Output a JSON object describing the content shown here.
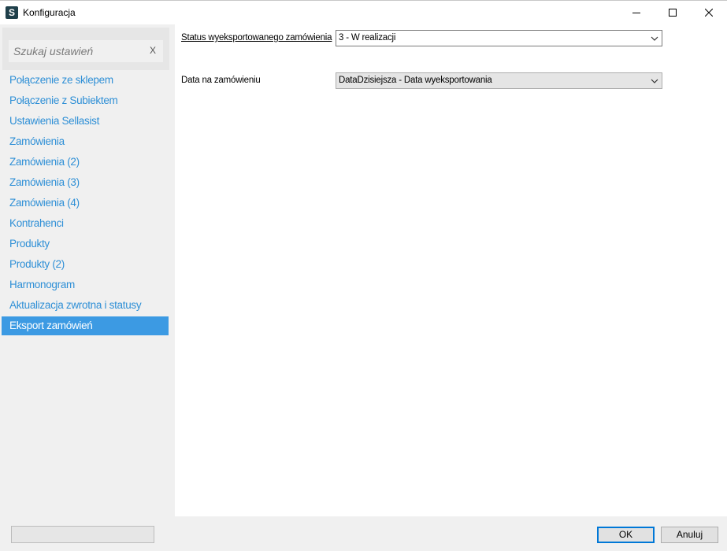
{
  "window": {
    "title": "Konfiguracja",
    "icon_letter": "S",
    "controls": [
      "minimize-icon",
      "maximize-icon",
      "close-icon"
    ]
  },
  "sidebar": {
    "search": {
      "placeholder": "Szukaj ustawień",
      "value": "",
      "clear_label": "X"
    },
    "items": [
      {
        "label": "Połączenie ze sklepem",
        "active": false
      },
      {
        "label": "Połączenie z Subiektem",
        "active": false
      },
      {
        "label": "Ustawienia Sellasist",
        "active": false
      },
      {
        "label": "Zamówienia",
        "active": false
      },
      {
        "label": "Zamówienia (2)",
        "active": false
      },
      {
        "label": "Zamówienia (3)",
        "active": false
      },
      {
        "label": "Zamówienia (4)",
        "active": false
      },
      {
        "label": "Kontrahenci",
        "active": false
      },
      {
        "label": "Produkty",
        "active": false
      },
      {
        "label": "Produkty (2)",
        "active": false
      },
      {
        "label": "Harmonogram",
        "active": false
      },
      {
        "label": "Aktualizacja zwrotna i statusy",
        "active": false
      },
      {
        "label": "Eksport zamówień",
        "active": true
      }
    ],
    "colors": {
      "link": "#2e8fd6",
      "active_bg": "#3c9ae3",
      "active_text": "#ffffff"
    }
  },
  "content": {
    "fields": {
      "status": {
        "label": "Status wyeksportowanego zamówienia",
        "value": "3 - W realizacji"
      },
      "date": {
        "label": "Data na zamówieniu",
        "value": "DataDzisiejsza - Data wyeksportowania"
      }
    }
  },
  "footer": {
    "ok_label": "OK",
    "cancel_label": "Anuluj"
  }
}
